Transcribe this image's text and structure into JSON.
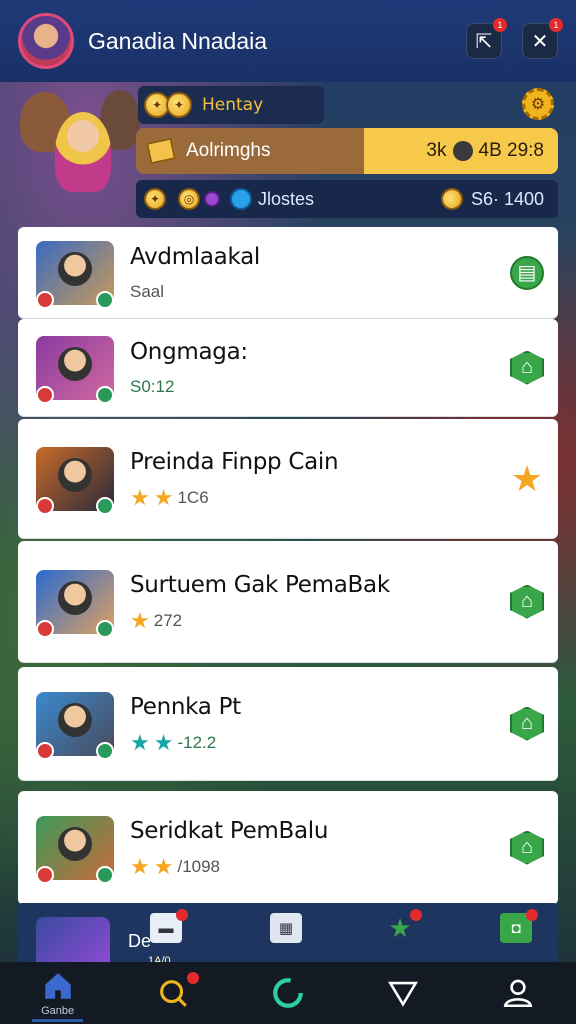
{
  "header": {
    "title": "Ganadia Nnadaia",
    "share_badge": "1",
    "close_badge": "1"
  },
  "status": {
    "row1_label": "Hentay",
    "row2_label": "Aolrimghs",
    "row2_value_a": "3k",
    "row2_value_b": "4B 29:8",
    "row3_label": "Jlostes",
    "row3_value": "S6· 1400"
  },
  "list": [
    {
      "title": "Avdmlaakal",
      "meta": "Saal",
      "meta_style": "plain",
      "stars": 0,
      "action": "circle",
      "thumb_colors": [
        "#3a6ac0",
        "#c89a5a"
      ]
    },
    {
      "title": "Ongmaga:",
      "meta": "S0:12",
      "meta_style": "green",
      "stars": 0,
      "action": "badge",
      "thumb_colors": [
        "#8a3aa0",
        "#d06aa0"
      ]
    },
    {
      "title": "Preinda Finpp Cain",
      "meta": "1C6",
      "meta_style": "plain",
      "stars": 2,
      "action": "orange-star",
      "thumb_colors": [
        "#c86a2a",
        "#2a2a3a"
      ]
    },
    {
      "title": "Surtuem Gak PemaBak",
      "meta": "272",
      "meta_style": "plain",
      "stars": 1,
      "action": "badge",
      "thumb_colors": [
        "#2a6ad0",
        "#e0a060"
      ]
    },
    {
      "title": "Pennka Pt",
      "meta": "-12.2",
      "meta_style": "green",
      "stars": 2,
      "star_color": "teal",
      "action": "badge",
      "thumb_colors": [
        "#3a8ad0",
        "#4a4a5a"
      ]
    },
    {
      "title": "Seridkat PemBalu",
      "meta": "/1098",
      "meta_style": "plain",
      "stars": 2,
      "action": "badge",
      "thumb_colors": [
        "#3a9a5a",
        "#c86a3a"
      ]
    }
  ],
  "bottom_strip": {
    "label": "De",
    "sublabel": "1A/0"
  },
  "nav": {
    "items": [
      {
        "name": "home",
        "label": "Ganbe"
      },
      {
        "name": "search",
        "label": ""
      },
      {
        "name": "progress",
        "label": ""
      },
      {
        "name": "filter",
        "label": ""
      },
      {
        "name": "profile",
        "label": ""
      }
    ]
  },
  "colors": {
    "header_bg": "#1f3a78",
    "gold": "#f7c94a",
    "green_action": "#3aa64a",
    "star": "#f5a623",
    "badge_red": "#e42a2a"
  }
}
